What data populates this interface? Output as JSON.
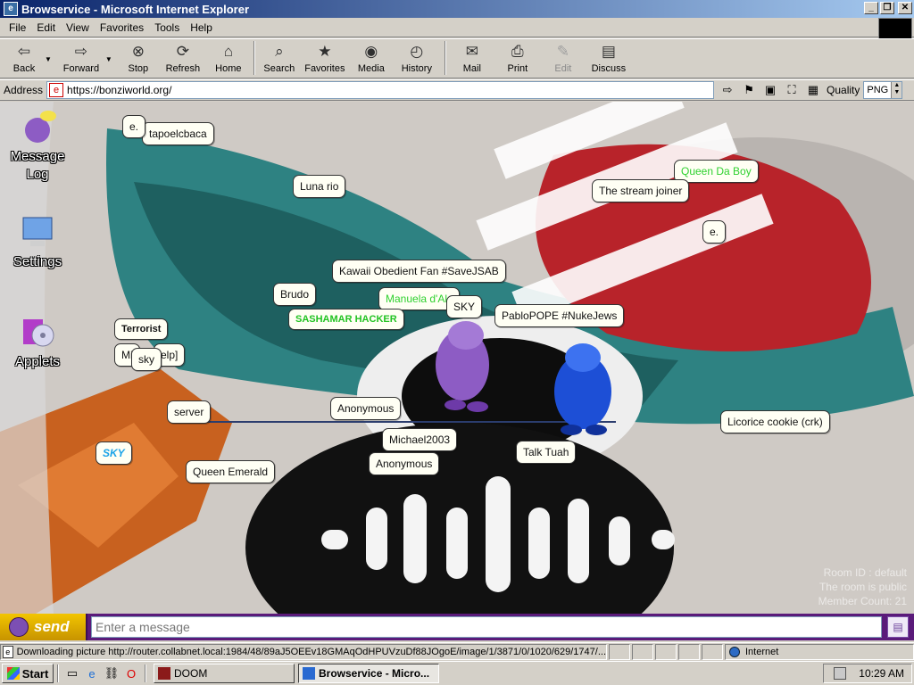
{
  "window": {
    "title": "Browservice - Microsoft Internet Explorer",
    "controls": [
      "_",
      "❐",
      "✕"
    ]
  },
  "menu": [
    {
      "key": "F",
      "rest": "ile"
    },
    {
      "key": "E",
      "rest": "dit"
    },
    {
      "key": "V",
      "rest": "iew"
    },
    {
      "key": "F",
      "rest": "avorites",
      "prefix": ""
    },
    {
      "key": "T",
      "rest": "ools"
    },
    {
      "key": "H",
      "rest": "elp"
    }
  ],
  "menu_labels": [
    "File",
    "Edit",
    "View",
    "Favorites",
    "Tools",
    "Help"
  ],
  "toolbar": {
    "back": "Back",
    "forward": "Forward",
    "stop": "Stop",
    "refresh": "Refresh",
    "home": "Home",
    "search": "Search",
    "favorites": "Favorites",
    "media": "Media",
    "history": "History",
    "mail": "Mail",
    "print": "Print",
    "edit": "Edit",
    "discuss": "Discuss"
  },
  "address": {
    "label": "Address",
    "url": "https://bonziworld.org/",
    "quality_label": "Quality",
    "quality_value": "PNG"
  },
  "desktop_icons": [
    {
      "label_1": "Message",
      "label_2": "Log"
    },
    {
      "label_1": "Settings"
    },
    {
      "label_1": "Applets"
    }
  ],
  "bubbles": [
    "e.",
    "tapoelcbaca",
    "Luna rio",
    "Queen Da Boy",
    "The stream joiner",
    "e.",
    "Kawaii Obedient Fan #SaveJSAB",
    "Brudo",
    "Manuela d'Alc",
    "SASHAMAR HACKER",
    "SKY",
    "PabloPOPE #NukeJews",
    "Terrorist",
    "Mi",
    "elp]",
    "sky",
    "server",
    "Anonymous",
    "Michael2003",
    "Anonymous",
    "Talk Tuah",
    "SKY",
    "Queen Emerald",
    "Licorice cookie (crk)"
  ],
  "room": {
    "id": "Room ID : default",
    "public": "The room is public",
    "members": "Member Count: 21"
  },
  "chat": {
    "send": "send",
    "placeholder": "Enter a message"
  },
  "status": {
    "text": "Downloading picture http://router.collabnet.local:1984/48/89aJ5OEEv18GMAqOdHPUVzuDf88JOgoE/image/1/3871/0/1020/629/1747/...",
    "zone": "Internet"
  },
  "taskbar": {
    "start": "Start",
    "tasks": [
      "DOOM",
      "Browservice - Micro..."
    ],
    "clock": "10:29 AM"
  },
  "colors": {
    "titlebar_start": "#0a246a",
    "chat_bar": "#5a1a7a",
    "send_button": "#f2c500",
    "bonzi_purple": "#8d5cc4",
    "bonzi_blue": "#1d4fd6"
  }
}
